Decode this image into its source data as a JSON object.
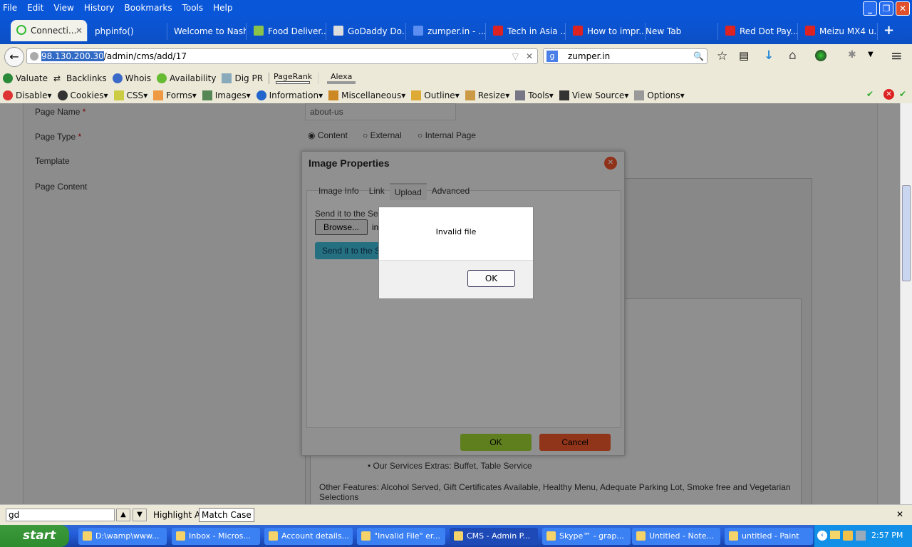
{
  "menu": [
    "File",
    "Edit",
    "View",
    "History",
    "Bookmarks",
    "Tools",
    "Help"
  ],
  "tabs": [
    {
      "label": "Connecti...",
      "active": true
    },
    {
      "label": "phpinfo()"
    },
    {
      "label": "Welcome to Nash..."
    },
    {
      "label": "Food Deliver..."
    },
    {
      "label": "GoDaddy Do..."
    },
    {
      "label": "zumper.in - ..."
    },
    {
      "label": "Tech in Asia ..."
    },
    {
      "label": "How to impr..."
    },
    {
      "label": "New Tab"
    },
    {
      "label": "Red Dot Pay..."
    },
    {
      "label": "Meizu MX4 u..."
    }
  ],
  "new_tab": "+",
  "url": {
    "host": "98.130.200.30",
    "path": "/admin/cms/add/17"
  },
  "search": {
    "value": "zumper.in"
  },
  "toolbar1": [
    "Valuate",
    "Backlinks",
    "Whois",
    "Availability",
    "Dig PR",
    "PageRank",
    "Alexa"
  ],
  "toolbar2": [
    "Disable",
    "Cookies",
    "CSS",
    "Forms",
    "Images",
    "Information",
    "Miscellaneous",
    "Outline",
    "Resize",
    "Tools",
    "View Source",
    "Options"
  ],
  "form": {
    "page_name_label": "Page Name",
    "page_name_value": "about-us",
    "required": "*",
    "page_type_label": "Page Type",
    "page_type_options": [
      "Content",
      "External",
      "Internal Page"
    ],
    "template_label": "Template",
    "page_content_label": "Page Content",
    "content_bullet": "Our Services Extras: Buffet, Table Service",
    "content_para": "Other Features: Alcohol Served, Gift Certificates Available, Healthy Menu, Adequate Parking Lot, Smoke free and Vegetarian Selections"
  },
  "image_dialog": {
    "title": "Image Properties",
    "tabs": [
      "Image Info",
      "Link",
      "Upload",
      "Advanced"
    ],
    "active_tab": "Upload",
    "send_label": "Send it to the Server",
    "browse": "Browse...",
    "file_text": "in",
    "send_button": "Send it to the Server",
    "ok": "OK",
    "cancel": "Cancel"
  },
  "alert": {
    "message": "Invalid file",
    "ok": "OK"
  },
  "findbar": {
    "value": "gd",
    "highlight_all": "Highlight All",
    "match_case": "Match Case"
  },
  "taskbar": {
    "start": "start",
    "items": [
      "D:\\wamp\\www...",
      "Inbox - Micros...",
      "Account details...",
      "\"Invalid File\" er...",
      "CMS - Admin P...",
      "Skype™ - grap...",
      "Untitled - Note...",
      "untitled - Paint"
    ],
    "active": "CMS - Admin P...",
    "clock": "2:57 PM"
  }
}
